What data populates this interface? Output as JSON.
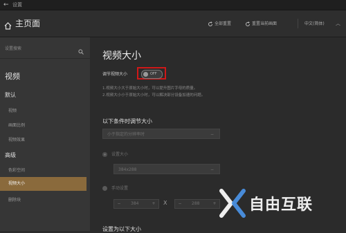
{
  "titlebar": {
    "title": "设置"
  },
  "topbar": {
    "home_title": "主页面",
    "reset_all": "全部重置",
    "reset_current": "重置当前画面",
    "language": "中文(简体)"
  },
  "sidebar": {
    "search_placeholder": "设置搜索",
    "section": "视频",
    "groups": [
      {
        "label": "默认",
        "items": [
          "视频",
          "画面比例",
          "视频效果"
        ]
      },
      {
        "label": "高级",
        "items": [
          "色彩空间",
          "视频大小",
          "删除块"
        ]
      }
    ],
    "active_item": "视频大小"
  },
  "main": {
    "title": "视频大小",
    "toggle_label": "调节视频大小",
    "toggle_state": "OFF",
    "notes": [
      "1.视频大小大于原始大小时，可以提升图片字母的质量。",
      "2.视频大小小于原始大小时，可以解决部分设备加速的问题。"
    ],
    "condition_heading": "以下条件时调节大小",
    "condition_select": "小于指定的分辨率时",
    "preset_label": "设置大小",
    "preset_select": "384x288",
    "manual_label": "手动设置",
    "width_value": "384",
    "height_value": "288",
    "times_sign": "X",
    "bottom_heading": "设置为以下大小"
  },
  "watermark": {
    "text": "自由互联"
  },
  "colors": {
    "accent_active": "#8a6a3c",
    "highlight_box": "#d01818",
    "background": "#2b2b2b",
    "sidebar": "#363636"
  }
}
